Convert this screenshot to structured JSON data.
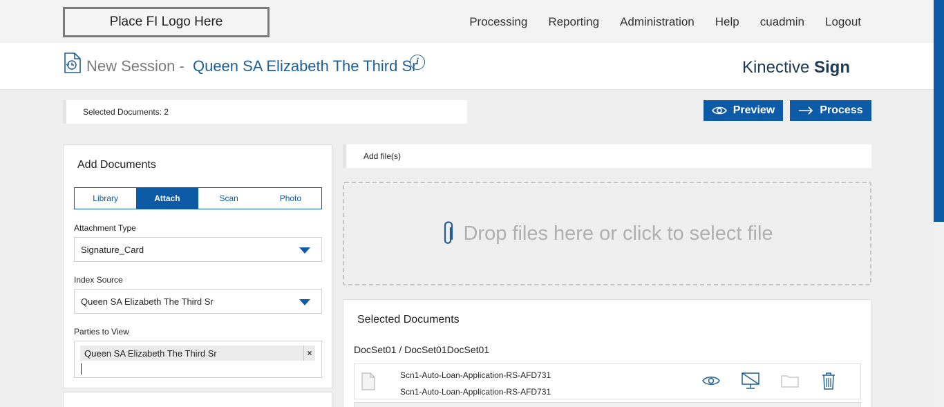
{
  "logo": {
    "text": "Place FI Logo Here"
  },
  "nav": {
    "items": [
      {
        "label": "Processing"
      },
      {
        "label": "Reporting"
      },
      {
        "label": "Administration"
      },
      {
        "label": "Help"
      },
      {
        "label": "cuadmin"
      },
      {
        "label": "Logout"
      }
    ]
  },
  "header": {
    "title_prefix": "New Session -",
    "session_name": "Queen SA Elizabeth The Third Sr",
    "info_icon": "i",
    "brand_regular": "Kinective",
    "brand_bold": "Sign"
  },
  "selected_bar": {
    "text": "Selected Documents: 2"
  },
  "actions": {
    "preview_label": "Preview",
    "process_label": "Process"
  },
  "add_documents": {
    "title": "Add Documents",
    "tabs": [
      {
        "label": "Library",
        "active": false
      },
      {
        "label": "Attach",
        "active": true
      },
      {
        "label": "Scan",
        "active": false
      },
      {
        "label": "Photo",
        "active": false
      }
    ],
    "attachment_type": {
      "label": "Attachment Type",
      "value": "Signature_Card"
    },
    "index_source": {
      "label": "Index Source",
      "value": "Queen SA Elizabeth The Third Sr"
    },
    "parties_to_view": {
      "label": "Parties to View",
      "chip": "Queen SA Elizabeth The Third Sr",
      "remove": "×"
    }
  },
  "add_files": {
    "label": "Add file(s)"
  },
  "dropzone": {
    "text": "Drop files here or click to select file",
    "icon": "paperclip-icon"
  },
  "selected_documents": {
    "title": "Selected Documents",
    "docset_path": "DocSet01 / DocSet01DocSet01",
    "rows": [
      {
        "line1": "Scn1-Auto-Loan-Application-RS-AFD731",
        "line2": "Scn1-Auto-Loan-Application-RS-AFD731",
        "icons": [
          "eye-icon",
          "monitor-off-icon",
          "folder-icon",
          "trash-icon"
        ]
      }
    ]
  },
  "colors": {
    "accent": "#0d5aa7",
    "link": "#1f5f94",
    "background": "#efefef"
  }
}
